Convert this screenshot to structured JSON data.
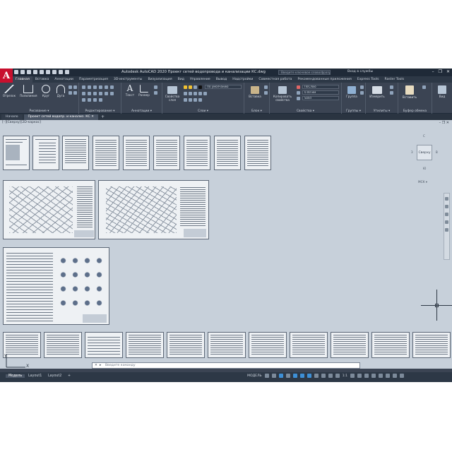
{
  "app": {
    "logo_letter": "A",
    "title": "Autodesk AutoCAD 2020   Проект сетей водопровода и канализации КС.dwg",
    "search_placeholder": "Введите ключевое слово/фразу",
    "signin": "Вход в службы",
    "window_buttons": [
      "–",
      "❐",
      "✕"
    ]
  },
  "ribbon_tabs": [
    "Главная",
    "Вставка",
    "Аннотации",
    "Параметризация",
    "3D-инструменты",
    "Визуализация",
    "Вид",
    "Управление",
    "Вывод",
    "Надстройки",
    "Совместная работа",
    "Рекомендованные приложения",
    "Express Tools",
    "Raster Tools"
  ],
  "ribbon_groups": {
    "draw": {
      "label": "Рисование ▾",
      "tools": [
        "Отрезок",
        "Полилиния",
        "Круг",
        "Дуга"
      ]
    },
    "modify": {
      "label": "Редактирование ▾"
    },
    "annotation": {
      "label": "Аннотации ▾",
      "tools": [
        "Текст",
        "Размер"
      ]
    },
    "layers": {
      "label": "Слои ▾",
      "tool": "Свойства слоя",
      "layer_value": "По умолчанию"
    },
    "block": {
      "label": "Блок ▾",
      "tool": "Вставка"
    },
    "properties": {
      "label": "Свойства ▾",
      "tool": "Копировать свойства",
      "color": "ПоСлою",
      "lineweight": "0.00 мм",
      "linetype": "Solid"
    },
    "groups": {
      "label": "Группы ▾",
      "tool": "Группа"
    },
    "utilities": {
      "label": "Утилиты ▾",
      "tool": "Измерить"
    },
    "clipboard": {
      "label": "Буфер обмена",
      "tool": "Вставить"
    },
    "view": {
      "label": "",
      "tool": "Вид"
    }
  },
  "doc_tabs": [
    {
      "label": "Начало",
      "active": false
    },
    {
      "label": "Проект сетей водопр. и канализ. КС ✕",
      "active": true
    },
    {
      "label": "+",
      "active": false
    }
  ],
  "viewport": {
    "label": "[–][Сверху][2D-каркас]",
    "window_controls": "– ❐ ✕",
    "viewcube_face": "Сверху",
    "viewcube_dirs": {
      "n": "С",
      "s": "Ю",
      "w": "З",
      "e": "В"
    },
    "wcs_label": "МСК ▾"
  },
  "command_line": {
    "placeholder": "Введите команду",
    "close_glyph": "✕",
    "prompt_glyph": "▸"
  },
  "status_bar": {
    "layout_tabs": [
      "Модель",
      "Layout1",
      "Layout2",
      "+"
    ],
    "mode_label": "МОДЕЛЬ",
    "scale_label": "1:1"
  }
}
